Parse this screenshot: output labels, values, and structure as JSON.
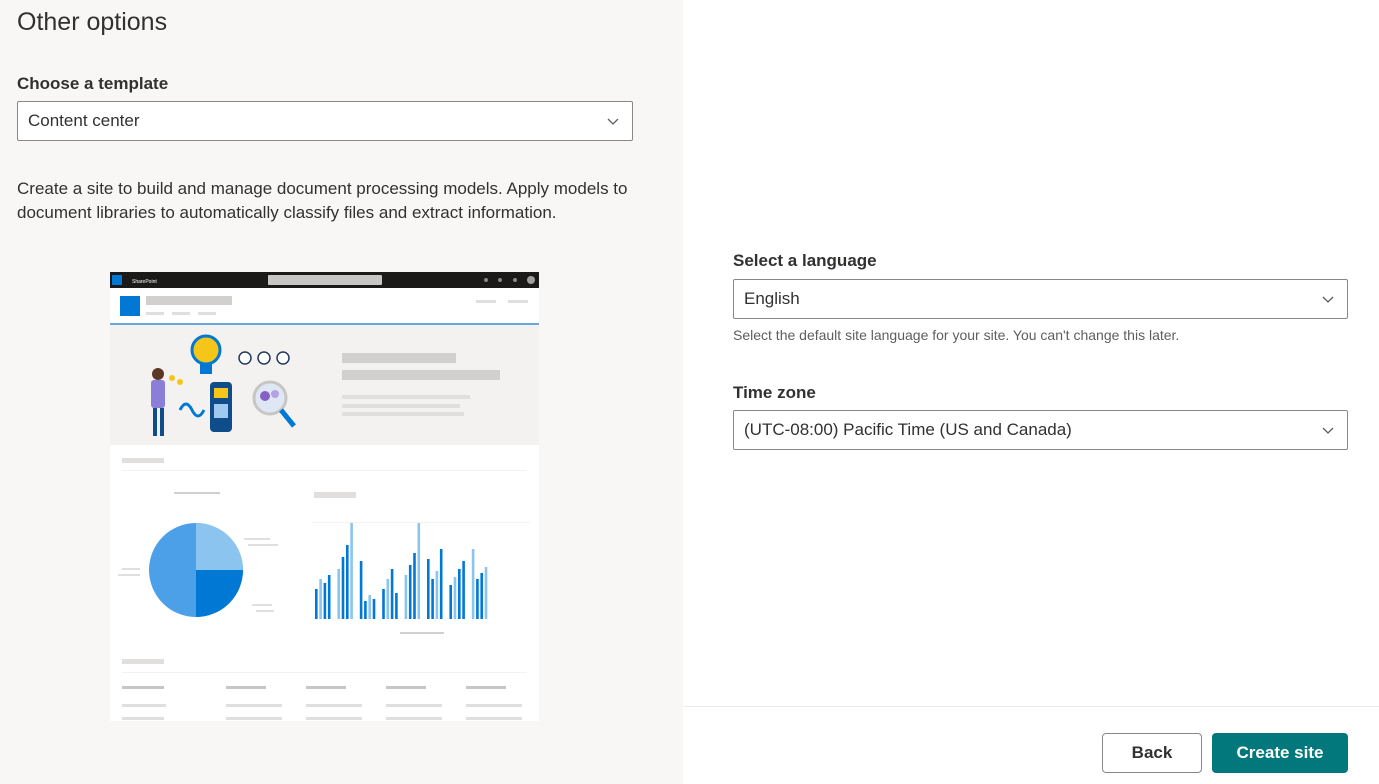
{
  "panel": {
    "title": "Other options",
    "template_label": "Choose a template",
    "template_value": "Content center",
    "template_description": "Create a site to build and manage document processing models. Apply models to document libraries to automatically classify files and extract information.",
    "preview": {
      "app_name": "SharePoint",
      "accent": "#0078d4"
    }
  },
  "settings": {
    "language_label": "Select a language",
    "language_value": "English",
    "language_hint": "Select the default site language for your site. You can't change this later.",
    "timezone_label": "Time zone",
    "timezone_value": "(UTC-08:00) Pacific Time (US and Canada)"
  },
  "footer": {
    "back_label": "Back",
    "create_label": "Create site",
    "create_color": "#03787c"
  },
  "icons": {
    "dropdown": "chevron-down-icon"
  }
}
